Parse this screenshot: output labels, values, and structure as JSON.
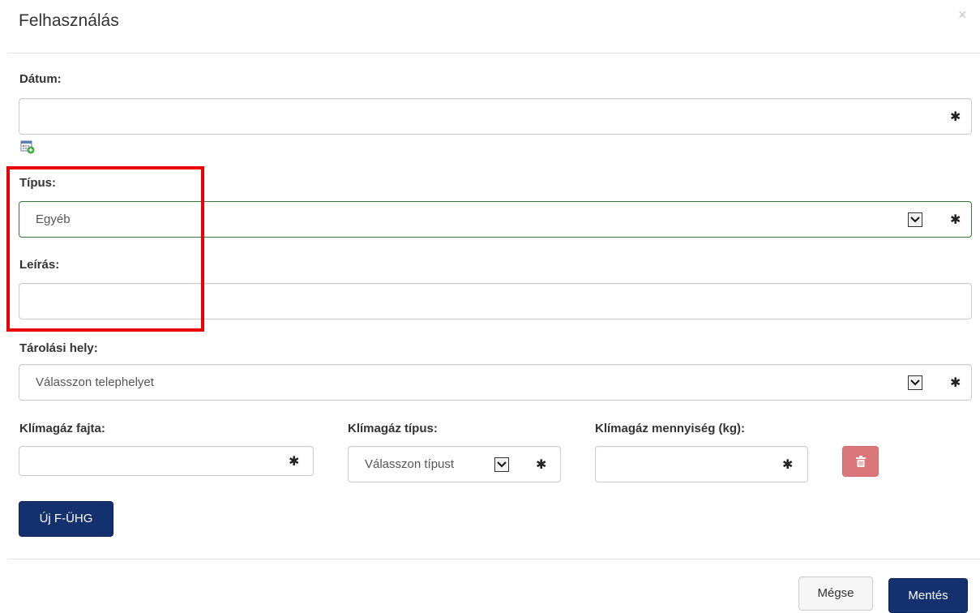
{
  "dialog": {
    "title": "Felhasználás",
    "close_glyph": "×"
  },
  "form": {
    "date": {
      "label": "Dátum:",
      "value": "",
      "required_mark": "✱"
    },
    "type": {
      "label": "Típus:",
      "selected": "Egyéb",
      "required_mark": "✱"
    },
    "description": {
      "label": "Leírás:",
      "value": ""
    },
    "storage": {
      "label": "Tárolási hely:",
      "selected": "Válasszon telephelyet",
      "required_mark": "✱"
    },
    "gas_kind": {
      "label": "Klímagáz fajta:",
      "value": "",
      "required_mark": "✱"
    },
    "gas_type": {
      "label": "Klímagáz típus:",
      "selected": "Válasszon típust",
      "required_mark": "✱"
    },
    "gas_amount": {
      "label": "Klímagáz mennyiség (kg):",
      "value": "",
      "required_mark": "✱"
    }
  },
  "buttons": {
    "new_fuhg": "Új F-ÜHG",
    "cancel": "Mégse",
    "save": "Mentés"
  },
  "icons": {
    "calendar": "calendar-add-icon",
    "trash": "trash-icon",
    "dropdown": "chevron-down-icon",
    "required": "asterisk-icon"
  },
  "colors": {
    "primary": "#12316e",
    "danger": "#d9777a",
    "valid_border": "#3c763d",
    "highlight": "#ee0000"
  }
}
